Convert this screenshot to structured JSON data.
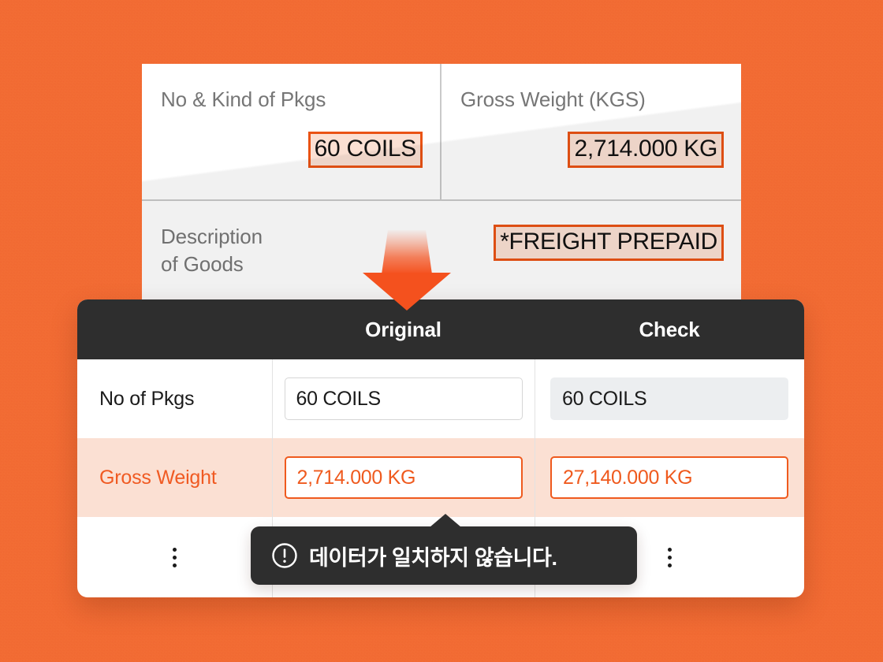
{
  "theme": {
    "background_color": "#F26B33",
    "accent_color": "#EF5A1E",
    "highlight_fill": "#FBE0D3",
    "header_bar_color": "#2E2E2E"
  },
  "document": {
    "fields": [
      {
        "label": "No & Kind of Pkgs",
        "value": "60 COILS"
      },
      {
        "label": "Gross Weight (KGS)",
        "value": "2,714.000 KG"
      },
      {
        "label": "Description\nof Goods",
        "label_line1": "Description",
        "label_line2": "of Goods",
        "value": "*FREIGHT PREPAID"
      }
    ]
  },
  "arrow": {
    "icon": "arrow-down-icon",
    "color": "#F4511E"
  },
  "comparison_table": {
    "columns": [
      "",
      "Original",
      "Check"
    ],
    "header": {
      "col1_label": "",
      "col2_label": "Original",
      "col3_label": "Check"
    },
    "rows": [
      {
        "label": "No of Pkgs",
        "original": "60 COILS",
        "check": "60 COILS",
        "mismatch": false
      },
      {
        "label": "Gross Weight",
        "original": "2,714.000 KG",
        "check": "27,140.000 KG",
        "mismatch": true
      }
    ],
    "overflow_menu_icon": "kebab-menu-icon"
  },
  "tooltip": {
    "icon": "alert-circle-icon",
    "message": "데이터가 일치하지 않습니다."
  }
}
